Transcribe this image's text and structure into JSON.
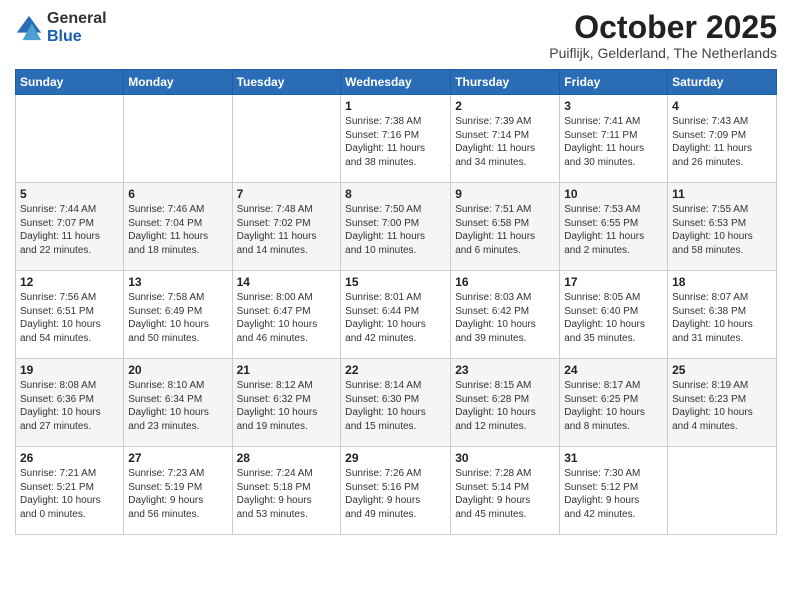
{
  "logo": {
    "general": "General",
    "blue": "Blue"
  },
  "title": "October 2025",
  "subtitle": "Puiflijk, Gelderland, The Netherlands",
  "weekdays": [
    "Sunday",
    "Monday",
    "Tuesday",
    "Wednesday",
    "Thursday",
    "Friday",
    "Saturday"
  ],
  "weeks": [
    [
      {
        "day": "",
        "info": ""
      },
      {
        "day": "",
        "info": ""
      },
      {
        "day": "",
        "info": ""
      },
      {
        "day": "1",
        "info": "Sunrise: 7:38 AM\nSunset: 7:16 PM\nDaylight: 11 hours\nand 38 minutes."
      },
      {
        "day": "2",
        "info": "Sunrise: 7:39 AM\nSunset: 7:14 PM\nDaylight: 11 hours\nand 34 minutes."
      },
      {
        "day": "3",
        "info": "Sunrise: 7:41 AM\nSunset: 7:11 PM\nDaylight: 11 hours\nand 30 minutes."
      },
      {
        "day": "4",
        "info": "Sunrise: 7:43 AM\nSunset: 7:09 PM\nDaylight: 11 hours\nand 26 minutes."
      }
    ],
    [
      {
        "day": "5",
        "info": "Sunrise: 7:44 AM\nSunset: 7:07 PM\nDaylight: 11 hours\nand 22 minutes."
      },
      {
        "day": "6",
        "info": "Sunrise: 7:46 AM\nSunset: 7:04 PM\nDaylight: 11 hours\nand 18 minutes."
      },
      {
        "day": "7",
        "info": "Sunrise: 7:48 AM\nSunset: 7:02 PM\nDaylight: 11 hours\nand 14 minutes."
      },
      {
        "day": "8",
        "info": "Sunrise: 7:50 AM\nSunset: 7:00 PM\nDaylight: 11 hours\nand 10 minutes."
      },
      {
        "day": "9",
        "info": "Sunrise: 7:51 AM\nSunset: 6:58 PM\nDaylight: 11 hours\nand 6 minutes."
      },
      {
        "day": "10",
        "info": "Sunrise: 7:53 AM\nSunset: 6:55 PM\nDaylight: 11 hours\nand 2 minutes."
      },
      {
        "day": "11",
        "info": "Sunrise: 7:55 AM\nSunset: 6:53 PM\nDaylight: 10 hours\nand 58 minutes."
      }
    ],
    [
      {
        "day": "12",
        "info": "Sunrise: 7:56 AM\nSunset: 6:51 PM\nDaylight: 10 hours\nand 54 minutes."
      },
      {
        "day": "13",
        "info": "Sunrise: 7:58 AM\nSunset: 6:49 PM\nDaylight: 10 hours\nand 50 minutes."
      },
      {
        "day": "14",
        "info": "Sunrise: 8:00 AM\nSunset: 6:47 PM\nDaylight: 10 hours\nand 46 minutes."
      },
      {
        "day": "15",
        "info": "Sunrise: 8:01 AM\nSunset: 6:44 PM\nDaylight: 10 hours\nand 42 minutes."
      },
      {
        "day": "16",
        "info": "Sunrise: 8:03 AM\nSunset: 6:42 PM\nDaylight: 10 hours\nand 39 minutes."
      },
      {
        "day": "17",
        "info": "Sunrise: 8:05 AM\nSunset: 6:40 PM\nDaylight: 10 hours\nand 35 minutes."
      },
      {
        "day": "18",
        "info": "Sunrise: 8:07 AM\nSunset: 6:38 PM\nDaylight: 10 hours\nand 31 minutes."
      }
    ],
    [
      {
        "day": "19",
        "info": "Sunrise: 8:08 AM\nSunset: 6:36 PM\nDaylight: 10 hours\nand 27 minutes."
      },
      {
        "day": "20",
        "info": "Sunrise: 8:10 AM\nSunset: 6:34 PM\nDaylight: 10 hours\nand 23 minutes."
      },
      {
        "day": "21",
        "info": "Sunrise: 8:12 AM\nSunset: 6:32 PM\nDaylight: 10 hours\nand 19 minutes."
      },
      {
        "day": "22",
        "info": "Sunrise: 8:14 AM\nSunset: 6:30 PM\nDaylight: 10 hours\nand 15 minutes."
      },
      {
        "day": "23",
        "info": "Sunrise: 8:15 AM\nSunset: 6:28 PM\nDaylight: 10 hours\nand 12 minutes."
      },
      {
        "day": "24",
        "info": "Sunrise: 8:17 AM\nSunset: 6:25 PM\nDaylight: 10 hours\nand 8 minutes."
      },
      {
        "day": "25",
        "info": "Sunrise: 8:19 AM\nSunset: 6:23 PM\nDaylight: 10 hours\nand 4 minutes."
      }
    ],
    [
      {
        "day": "26",
        "info": "Sunrise: 7:21 AM\nSunset: 5:21 PM\nDaylight: 10 hours\nand 0 minutes."
      },
      {
        "day": "27",
        "info": "Sunrise: 7:23 AM\nSunset: 5:19 PM\nDaylight: 9 hours\nand 56 minutes."
      },
      {
        "day": "28",
        "info": "Sunrise: 7:24 AM\nSunset: 5:18 PM\nDaylight: 9 hours\nand 53 minutes."
      },
      {
        "day": "29",
        "info": "Sunrise: 7:26 AM\nSunset: 5:16 PM\nDaylight: 9 hours\nand 49 minutes."
      },
      {
        "day": "30",
        "info": "Sunrise: 7:28 AM\nSunset: 5:14 PM\nDaylight: 9 hours\nand 45 minutes."
      },
      {
        "day": "31",
        "info": "Sunrise: 7:30 AM\nSunset: 5:12 PM\nDaylight: 9 hours\nand 42 minutes."
      },
      {
        "day": "",
        "info": ""
      }
    ]
  ]
}
